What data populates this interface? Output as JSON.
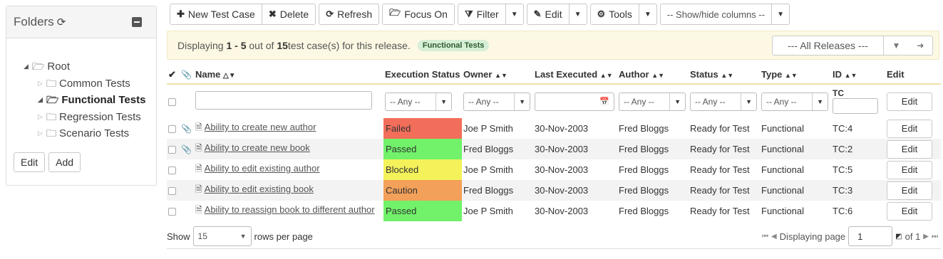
{
  "folders": {
    "title": "Folders",
    "tree": {
      "root": "Root",
      "children": [
        "Common Tests",
        "Functional Tests",
        "Regression Tests",
        "Scenario Tests"
      ]
    },
    "edit_label": "Edit",
    "add_label": "Add"
  },
  "toolbar": {
    "new_test_case": "New Test Case",
    "delete": "Delete",
    "refresh": "Refresh",
    "focus_on": "Focus On",
    "filter": "Filter",
    "edit": "Edit",
    "tools": "Tools",
    "show_hide_columns": "-- Show/hide columns --"
  },
  "info": {
    "prefix": "Displaying ",
    "range": "1 - 5",
    "mid": " out of ",
    "total": "15",
    "suffix": " test case(s) for this release.",
    "folder_badge": "Functional Tests",
    "release_select": "--- All Releases ---"
  },
  "grid": {
    "headers": {
      "name": "Name",
      "execution_status": "Execution Status",
      "owner": "Owner",
      "last_executed": "Last Executed",
      "author": "Author",
      "status": "Status",
      "type": "Type",
      "id": "ID",
      "edit": "Edit"
    },
    "filters": {
      "any": "-- Any --",
      "id_prefix": "TC"
    },
    "edit_label": "Edit",
    "rows": [
      {
        "name": "Ability to create new author",
        "execution_status": "Failed",
        "status_color": "#f26e5a",
        "owner": "Joe P Smith",
        "last_executed": "30-Nov-2003",
        "author": "Fred Bloggs",
        "status": "Ready for Test",
        "type": "Functional",
        "id": "TC:4"
      },
      {
        "name": "Ability to create new book",
        "execution_status": "Passed",
        "status_color": "#71f26a",
        "owner": "Fred Bloggs",
        "last_executed": "30-Nov-2003",
        "author": "Fred Bloggs",
        "status": "Ready for Test",
        "type": "Functional",
        "id": "TC:2"
      },
      {
        "name": "Ability to edit existing author",
        "execution_status": "Blocked",
        "status_color": "#f4f25a",
        "owner": "Joe P Smith",
        "last_executed": "30-Nov-2003",
        "author": "Fred Bloggs",
        "status": "Ready for Test",
        "type": "Functional",
        "id": "TC:5"
      },
      {
        "name": "Ability to edit existing book",
        "execution_status": "Caution",
        "status_color": "#f2a05a",
        "owner": "Fred Bloggs",
        "last_executed": "30-Nov-2003",
        "author": "Fred Bloggs",
        "status": "Ready for Test",
        "type": "Functional",
        "id": "TC:3"
      },
      {
        "name": "Ability to reassign book to different author",
        "execution_status": "Passed",
        "status_color": "#71f26a",
        "owner": "Joe P Smith",
        "last_executed": "30-Nov-2003",
        "author": "Fred Bloggs",
        "status": "Ready for Test",
        "type": "Functional",
        "id": "TC:6"
      }
    ]
  },
  "footer": {
    "show": "Show",
    "rows_value": "15",
    "rows_per_page": "rows per page",
    "displaying_page": "Displaying page",
    "page_value": "1",
    "of_pages": "of 1"
  },
  "colors": {
    "accent_border": "#f1e0a6",
    "info_bg": "#fcf8e3",
    "alt_row": "#f3f3f3"
  }
}
